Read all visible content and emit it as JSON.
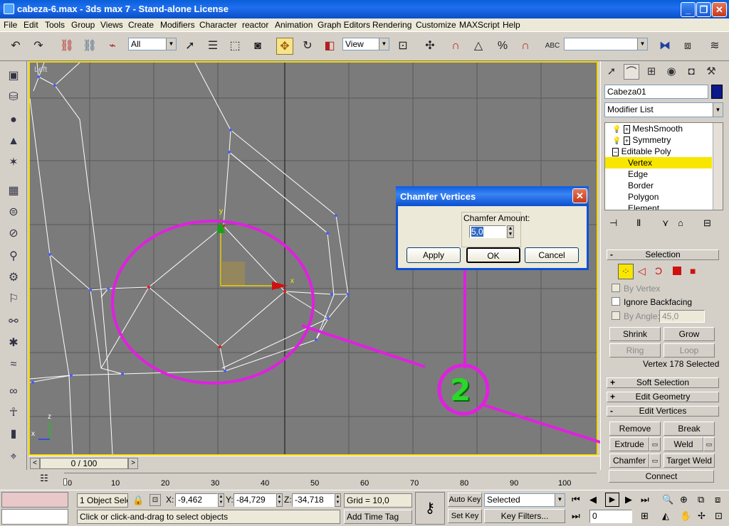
{
  "window": {
    "title": "cabeza-6.max - 3ds max 7 - Stand-alone License",
    "minimize": "_",
    "restore": "❐",
    "close": "✕"
  },
  "menu": [
    "File",
    "Edit",
    "Tools",
    "Group",
    "Views",
    "Create",
    "Modifiers",
    "Character",
    "reactor",
    "Animation",
    "Graph Editors",
    "Rendering",
    "Customize",
    "MAXScript",
    "Help"
  ],
  "toolbar": {
    "selection_filter": "All",
    "ref_coord": "View",
    "named_selection": ""
  },
  "viewport": {
    "label": "Left",
    "axis_y": "y",
    "axis_x": "x",
    "axis_z": "z",
    "tripod_x": "x",
    "tripod_z": "z"
  },
  "annotation": {
    "step": "2"
  },
  "dialog": {
    "title": "Chamfer Vertices",
    "amount_label": "Chamfer Amount:",
    "amount_value": "5,0",
    "apply": "Apply",
    "ok": "OK",
    "cancel": "Cancel"
  },
  "panel": {
    "object_name": "Cabeza01",
    "object_color": "#0a1a8c",
    "modifier_list": "Modifier List",
    "stack": [
      {
        "label": "MeshSmooth"
      },
      {
        "label": "Symmetry"
      },
      {
        "label": "Editable Poly"
      },
      {
        "label": "Vertex"
      },
      {
        "label": "Edge"
      },
      {
        "label": "Border"
      },
      {
        "label": "Polygon"
      },
      {
        "label": "Element"
      }
    ],
    "selection": {
      "header": "Selection",
      "by_vertex": "By Vertex",
      "ignore_backfacing": "Ignore Backfacing",
      "by_angle": "By Angle:",
      "angle_value": "45,0",
      "shrink": "Shrink",
      "grow": "Grow",
      "ring": "Ring",
      "loop": "Loop",
      "status": "Vertex 178 Selected"
    },
    "soft_selection": "Soft Selection",
    "edit_geometry": "Edit Geometry",
    "edit_vertices": {
      "header": "Edit Vertices",
      "remove": "Remove",
      "break": "Break",
      "extrude": "Extrude",
      "weld": "Weld",
      "chamfer": "Chamfer",
      "target_weld": "Target Weld",
      "connect": "Connect"
    }
  },
  "timeline": {
    "frame": "0 / 100",
    "ticks": [
      "0",
      "10",
      "20",
      "30",
      "40",
      "50",
      "60",
      "70",
      "80",
      "90",
      "100"
    ]
  },
  "status": {
    "selected": "1 Object Sele",
    "x_label": "X:",
    "x_value": "-9,462",
    "y_label": "Y:",
    "y_value": "-84,729",
    "z_label": "Z:",
    "z_value": "-34,718",
    "grid": "Grid = 10,0",
    "prompt": "Click or click-and-drag to select objects",
    "add_time_tag": "Add Time Tag",
    "auto_key": "Auto Key",
    "set_key": "Set Key",
    "selected_combo": "Selected",
    "key_filters": "Key Filters...",
    "frame_field": "0"
  }
}
